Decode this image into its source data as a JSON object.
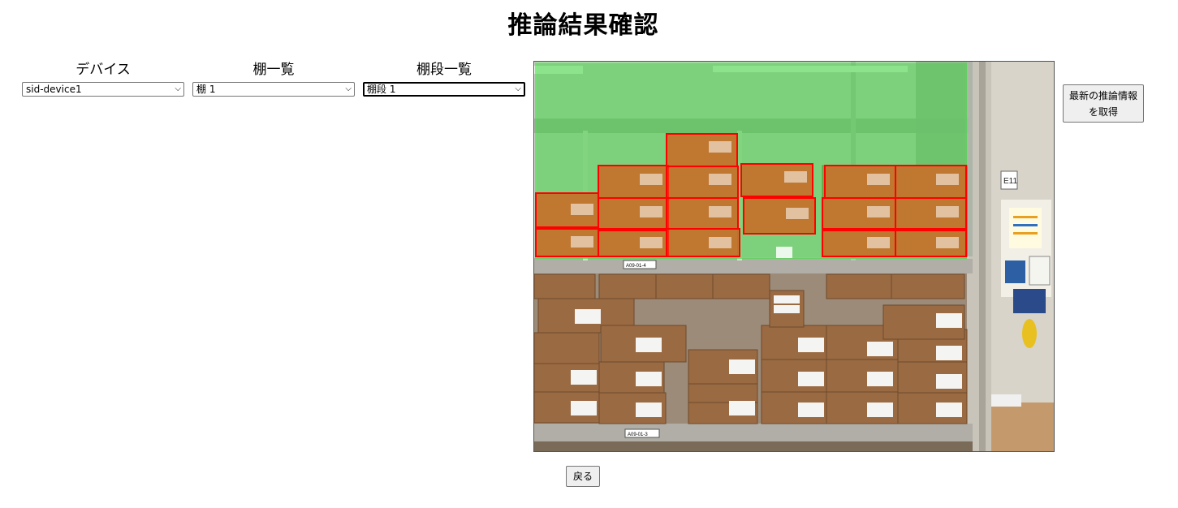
{
  "header": {
    "title": "推論結果確認"
  },
  "selectors": {
    "device": {
      "label": "デバイス",
      "value": "sid-device1"
    },
    "shelf": {
      "label": "棚一覧",
      "value": "棚 1"
    },
    "tier": {
      "label": "棚段一覧",
      "value": "棚段 1"
    }
  },
  "image": {
    "shelf_labels": [
      "A09-01-4",
      "A09-01-3"
    ],
    "sign_text": "E11",
    "detection_colors": {
      "region": "#3ccd3c",
      "box": "#ff0000",
      "box_fill": "#ff4a1a"
    }
  },
  "actions": {
    "refresh_label": "最新の推論情報を取得",
    "back_label": "戻る"
  },
  "icons": {
    "dropdown": "chevron-down-icon"
  }
}
